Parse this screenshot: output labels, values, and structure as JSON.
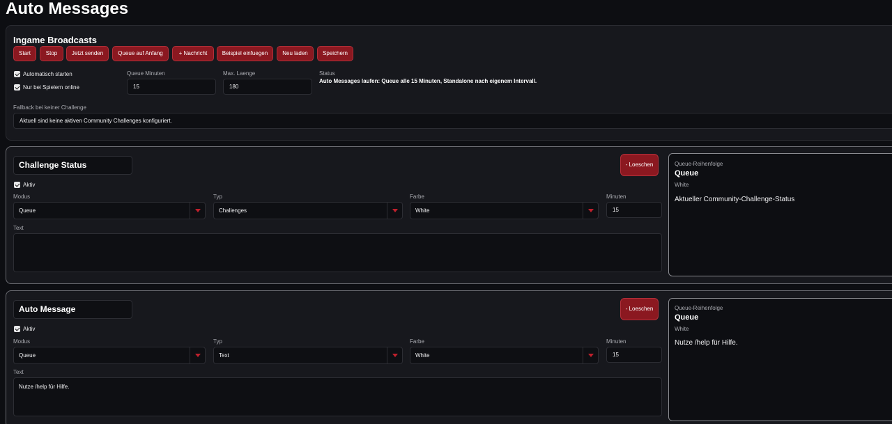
{
  "page": {
    "title": "Auto Messages"
  },
  "broadcasts": {
    "title": "Ingame Broadcasts",
    "buttons": {
      "start": "Start",
      "stop": "Stop",
      "send_now": "Jetzt senden",
      "queue_reset": "Queue auf Anfang",
      "add_message": "+ Nachricht",
      "insert_example": "Beispiel einfuegen",
      "reload": "Neu laden",
      "save": "Speichern"
    },
    "auto_start_label": "Automatisch starten",
    "only_players_label": "Nur bei Spielern online",
    "queue_minutes_label": "Queue Minuten",
    "queue_minutes_value": "15",
    "max_length_label": "Max. Laenge",
    "max_length_value": "180",
    "status_label": "Status",
    "status_value": "Auto Messages laufen: Queue alle 15 Minuten, Standalone nach eigenem Intervall.",
    "fallback_label": "Fallback bei keiner Challenge",
    "fallback_value": "Aktuell sind keine aktiven Community Challenges konfiguriert."
  },
  "messages": [
    {
      "name": "Challenge Status",
      "delete_label": "- Loeschen",
      "active_label": "Aktiv",
      "mode_label": "Modus",
      "mode_value": "Queue",
      "type_label": "Typ",
      "type_value": "Challenges",
      "color_label": "Farbe",
      "color_value": "White",
      "minutes_label": "Minuten",
      "minutes_value": "15",
      "text_label": "Text",
      "text_value": "",
      "preview": {
        "order_label": "Queue-Reihenfolge",
        "title": "Queue",
        "color": "White",
        "body": "Aktueller Community-Challenge-Status"
      }
    },
    {
      "name": "Auto Message",
      "delete_label": "- Loeschen",
      "active_label": "Aktiv",
      "mode_label": "Modus",
      "mode_value": "Queue",
      "type_label": "Typ",
      "type_value": "Text",
      "color_label": "Farbe",
      "color_value": "White",
      "minutes_label": "Minuten",
      "minutes_value": "15",
      "text_label": "Text",
      "text_value": "Nutze /help für Hilfe.",
      "preview": {
        "order_label": "Queue-Reihenfolge",
        "title": "Queue",
        "color": "White",
        "body": "Nutze /help für Hilfe."
      }
    }
  ],
  "colors": {
    "accent": "#8b1820",
    "accent_border": "#b3303a",
    "arrow": "#c0202c",
    "background": "#0d0e12",
    "panel": "#17181d"
  }
}
